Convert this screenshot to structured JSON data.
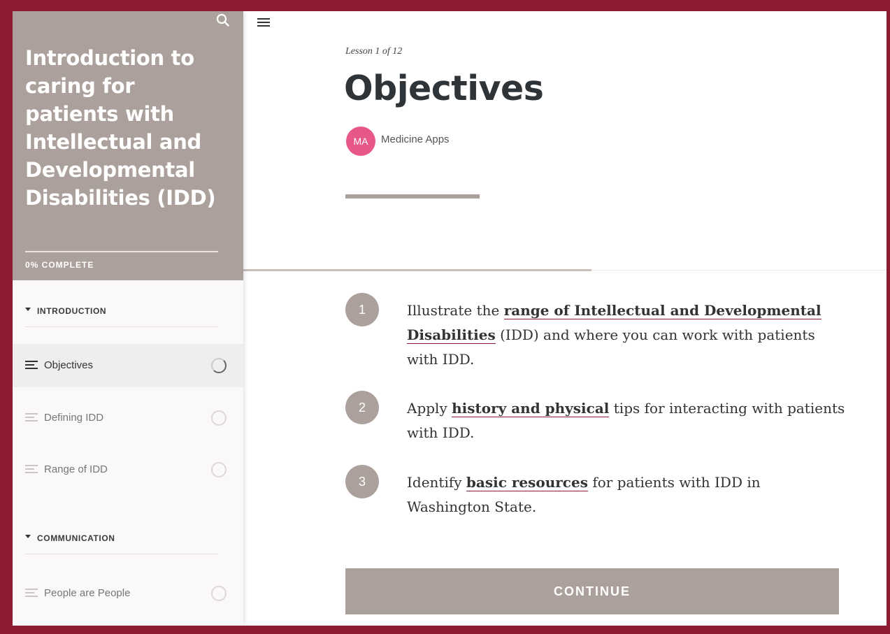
{
  "course": {
    "title": "Introduction to caring for patients with Intellectual and Developmental Disabilities (IDD)",
    "progress_label": "0% COMPLETE",
    "progress_fraction": 0
  },
  "sidebar": {
    "sections": [
      {
        "title": "INTRODUCTION",
        "lessons": [
          {
            "label": "Objectives",
            "active": true
          },
          {
            "label": "Defining IDD",
            "active": false
          },
          {
            "label": "Range of IDD",
            "active": false
          }
        ]
      },
      {
        "title": "COMMUNICATION",
        "lessons": [
          {
            "label": "People are People",
            "active": false
          }
        ]
      }
    ]
  },
  "lesson": {
    "count_label": "Lesson 1 of 12",
    "title": "Objectives",
    "author_initials": "MA",
    "author_name": "Medicine Apps"
  },
  "objectives": [
    {
      "number": "1",
      "pre": "Illustrate the",
      "bold": "range of Intellectual and Developmental Disabilities",
      "post": " (IDD) and where you can work with patients with IDD."
    },
    {
      "number": "2",
      "pre": "Apply",
      "bold": "history and physical",
      "post": " tips for interacting with patients with IDD."
    },
    {
      "number": "3",
      "pre": "Identify",
      "bold": "basic resources",
      "post": " for patients with IDD in Washington State."
    }
  ],
  "continue_label": "CONTINUE",
  "colors": {
    "frame": "#8e1b32",
    "sidebar_header": "#aba09b",
    "avatar": "#e8578a",
    "accent_underline": "#8e1b32"
  },
  "icons": {
    "search": "search-icon",
    "menu": "hamburger-icon",
    "lesson": "lines-icon",
    "status": "progress-circle-icon",
    "collapse": "caret-down-icon"
  }
}
